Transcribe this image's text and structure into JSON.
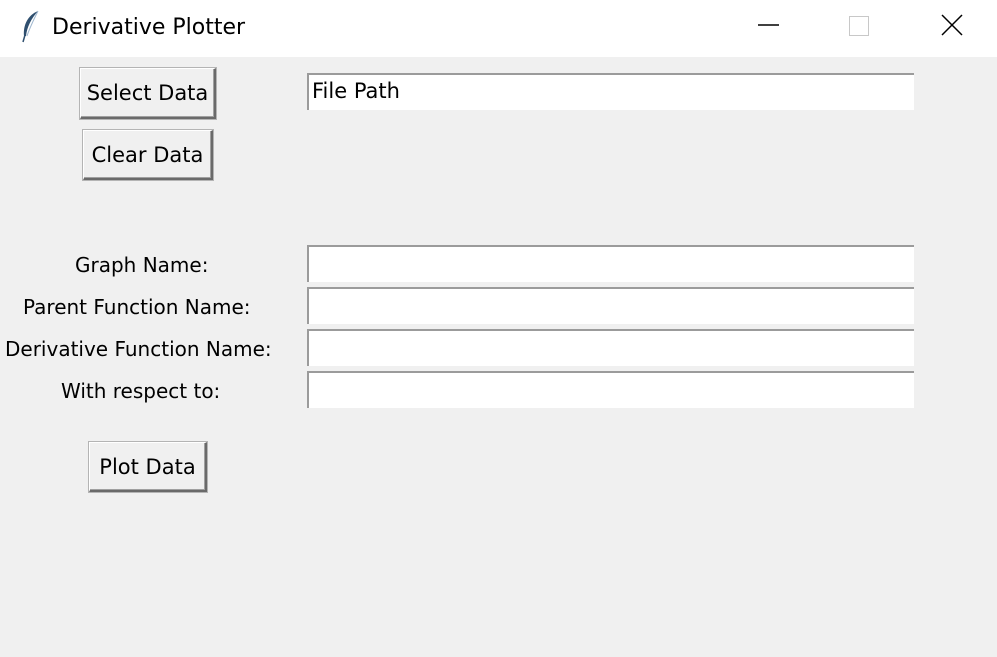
{
  "window": {
    "title": "Derivative Plotter",
    "icon": "feather-icon",
    "controls": {
      "minimize_icon": "minimize-icon",
      "maximize_icon": "maximize-icon",
      "close_icon": "close-icon"
    }
  },
  "data_section": {
    "select_button": "Select Data",
    "clear_button": "Clear Data",
    "file_path_value": "File Path"
  },
  "form": {
    "graph_name_label": "Graph Name:",
    "graph_name_value": "",
    "parent_function_label": "Parent Function Name:",
    "parent_function_value": "",
    "derivative_function_label": "Derivative Function Name:",
    "derivative_function_value": "",
    "respect_to_label": "With respect to:",
    "respect_to_value": ""
  },
  "actions": {
    "plot_button": "Plot Data"
  }
}
